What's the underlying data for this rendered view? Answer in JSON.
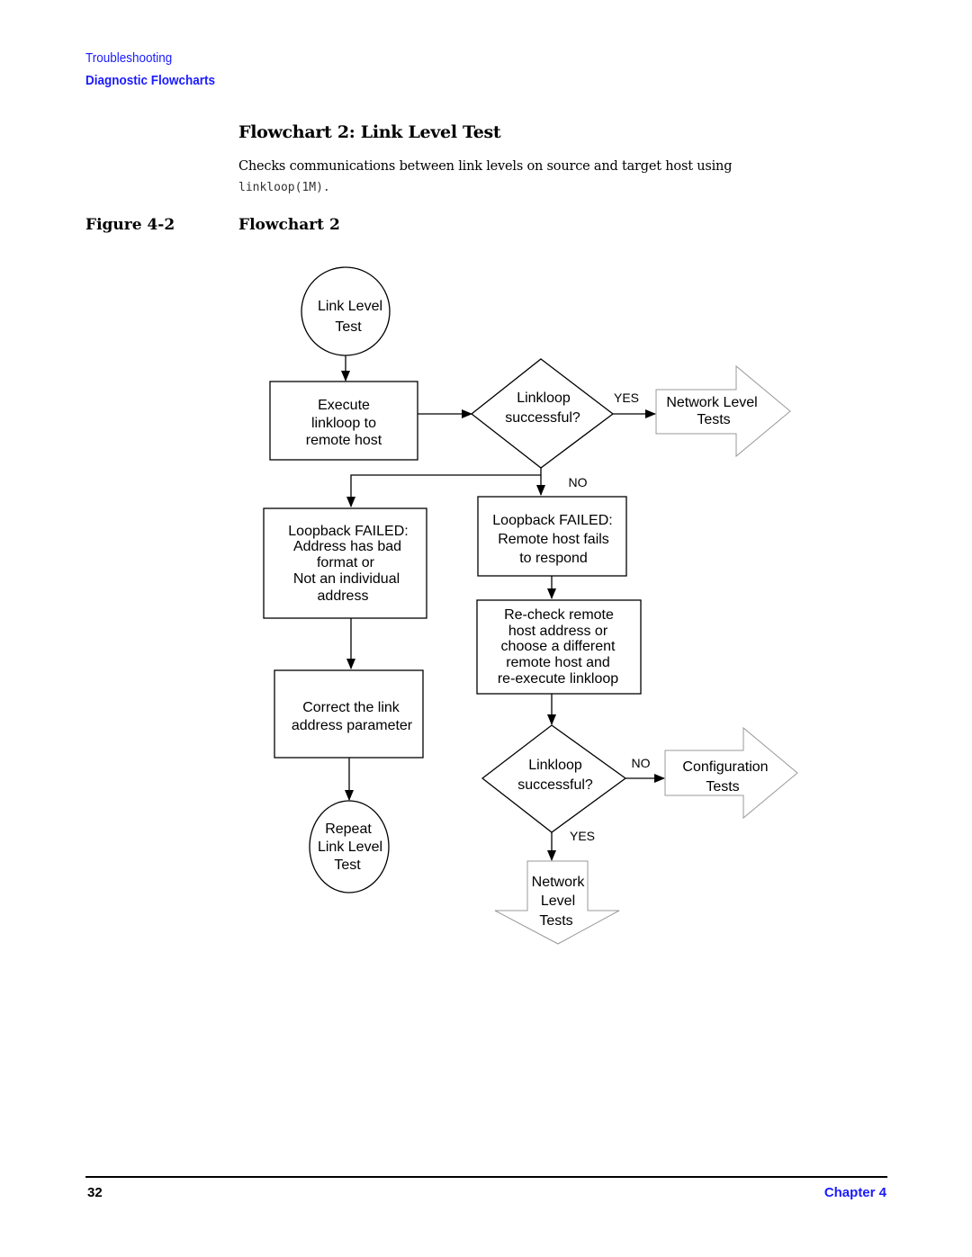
{
  "header": {
    "section": "Troubleshooting",
    "chapter_title": "Diagnostic Flowcharts"
  },
  "title": "Flowchart 2: Link Level Test",
  "description": {
    "text": "Checks communications between link levels on source and target host using",
    "code": "linkloop(1M)."
  },
  "figure": {
    "label": "Figure 4-2",
    "title": "Flowchart 2"
  },
  "flowchart": {
    "start": [
      "Link Level",
      "Test"
    ],
    "execute": [
      "Execute",
      "linkloop to",
      "remote host"
    ],
    "decision1": [
      "Linkloop",
      "successful?"
    ],
    "decision1_yes": "YES",
    "decision1_no": "NO",
    "network_level_tests_right": [
      "Network Level",
      "Tests"
    ],
    "fail_bad_address": [
      "Loopback FAILED:",
      "Address has bad",
      "format or",
      "Not an individual",
      "address"
    ],
    "fail_no_response": [
      "Loopback FAILED:",
      "Remote host fails",
      "to respond"
    ],
    "recheck": [
      "Re-check remote",
      "host address or",
      "choose a different",
      "remote host and",
      "re-execute linkloop"
    ],
    "correct": [
      "Correct the link",
      "address parameter"
    ],
    "repeat": [
      "Repeat",
      "Link Level",
      "Test"
    ],
    "decision2": [
      "Linkloop",
      "successful?"
    ],
    "decision2_no": "NO",
    "decision2_yes": "YES",
    "configuration_tests": [
      "Configuration",
      "Tests"
    ],
    "network_level_tests_down": [
      "Network",
      "Level",
      "Tests"
    ]
  },
  "footer": {
    "page_number": "32",
    "chapter": "Chapter 4"
  }
}
